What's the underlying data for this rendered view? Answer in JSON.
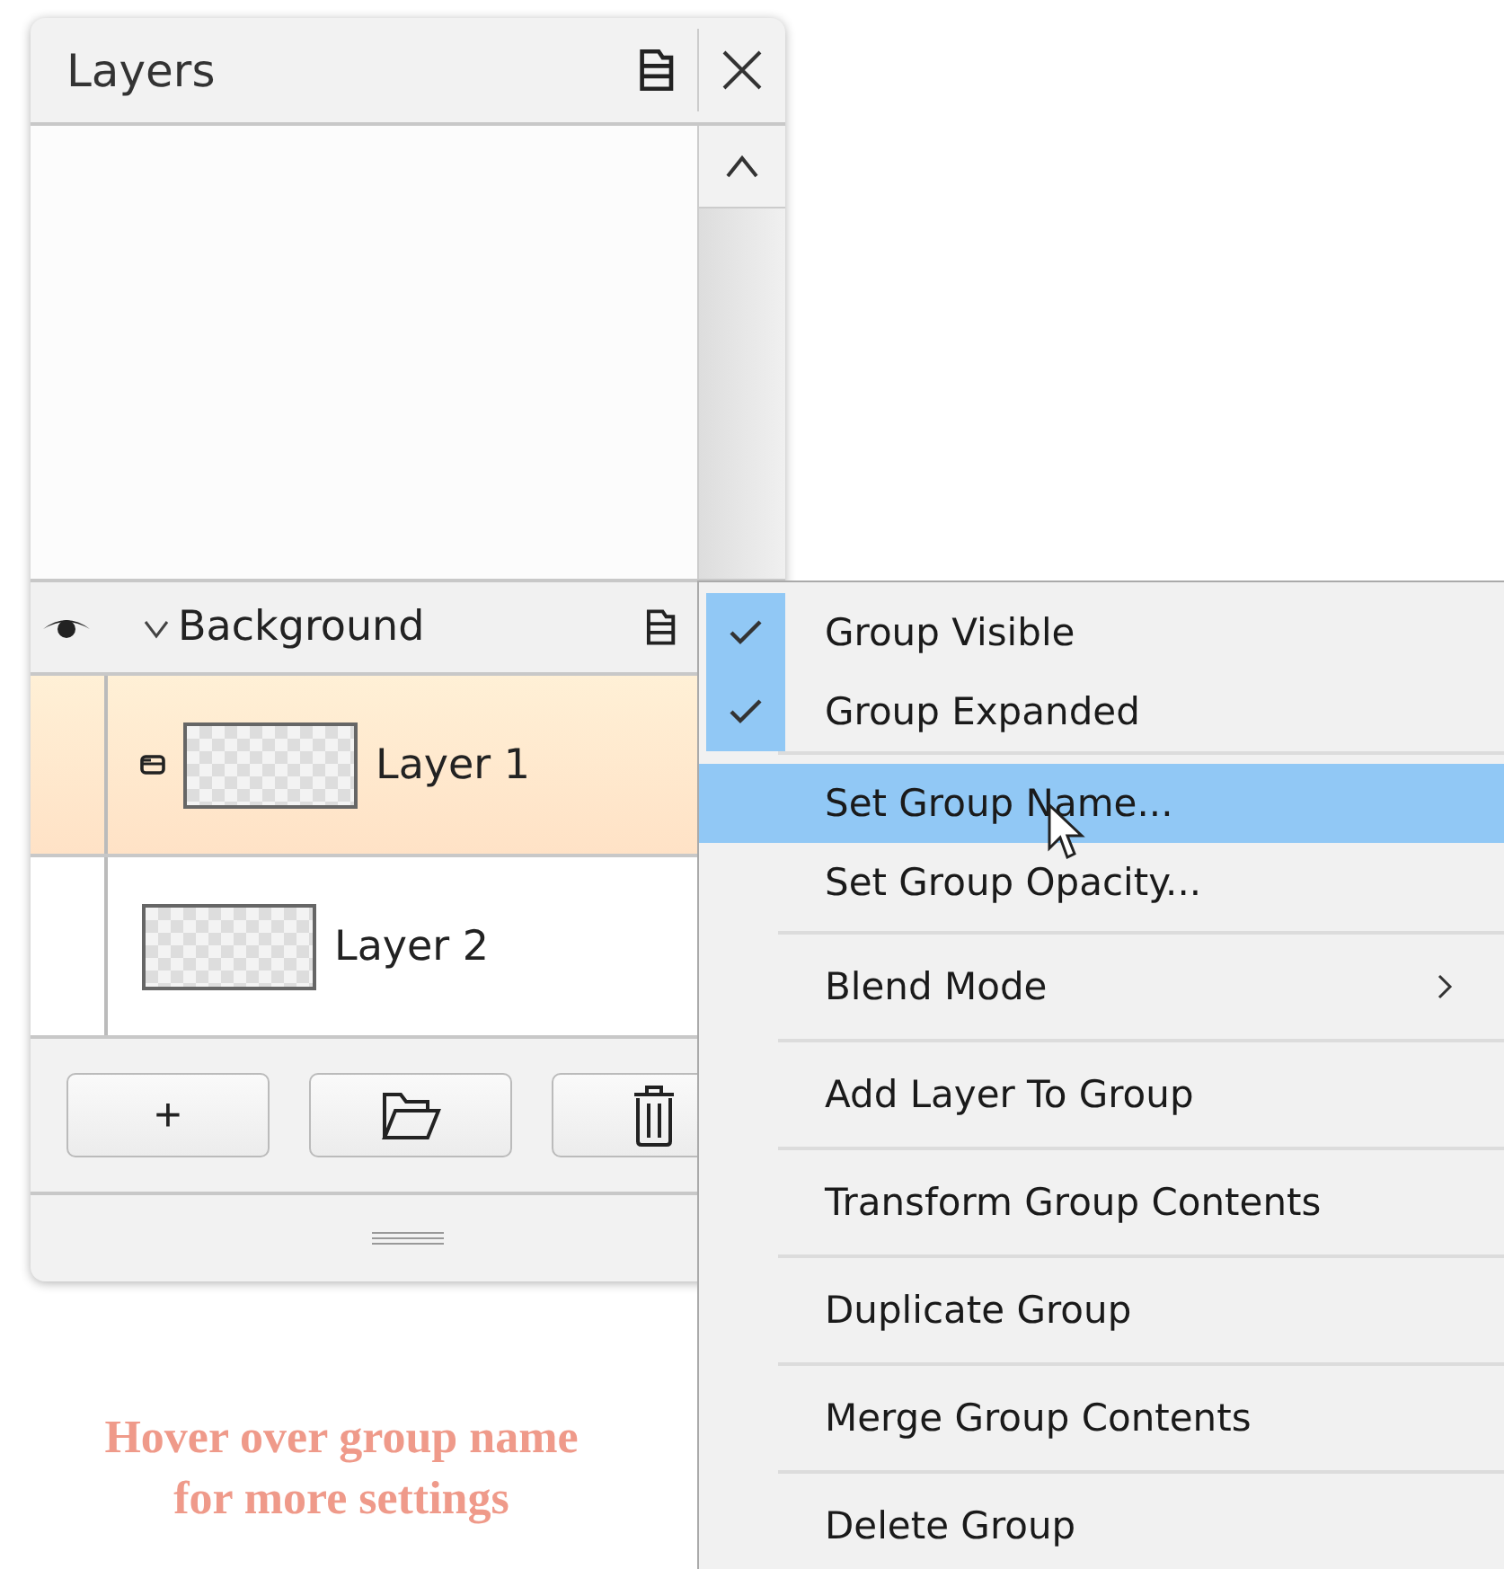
{
  "panel": {
    "title": "Layers",
    "group": {
      "name": "Background",
      "visible": true,
      "expanded": true
    },
    "layers": [
      {
        "name": "Layer 1",
        "selected": true,
        "badge": true
      },
      {
        "name": "Layer 2",
        "selected": false,
        "badge": false
      }
    ],
    "buttons": [
      {
        "kind": "add",
        "label": "+"
      },
      {
        "kind": "folder"
      },
      {
        "kind": "delete"
      }
    ]
  },
  "context_menu": {
    "groups": [
      [
        {
          "kind": "check",
          "label": "Group Visible",
          "checked": true,
          "highlighted": false
        },
        {
          "kind": "check",
          "label": "Group Expanded",
          "checked": true,
          "highlighted": false
        }
      ],
      [
        {
          "kind": "action",
          "label": "Set Group Name...",
          "highlighted": true
        },
        {
          "kind": "action",
          "label": "Set Group Opacity...",
          "highlighted": false
        }
      ],
      [
        {
          "kind": "submenu",
          "label": "Blend Mode",
          "highlighted": false
        }
      ],
      [
        {
          "kind": "action",
          "label": "Add Layer To Group",
          "highlighted": false
        }
      ],
      [
        {
          "kind": "action",
          "label": "Transform Group Contents",
          "highlighted": false
        }
      ],
      [
        {
          "kind": "action",
          "label": "Duplicate Group",
          "highlighted": false
        }
      ],
      [
        {
          "kind": "action",
          "label": "Merge Group Contents",
          "highlighted": false
        }
      ],
      [
        {
          "kind": "action",
          "label": "Delete Group",
          "highlighted": false
        }
      ]
    ]
  },
  "caption": "Hover over group name for more settings"
}
